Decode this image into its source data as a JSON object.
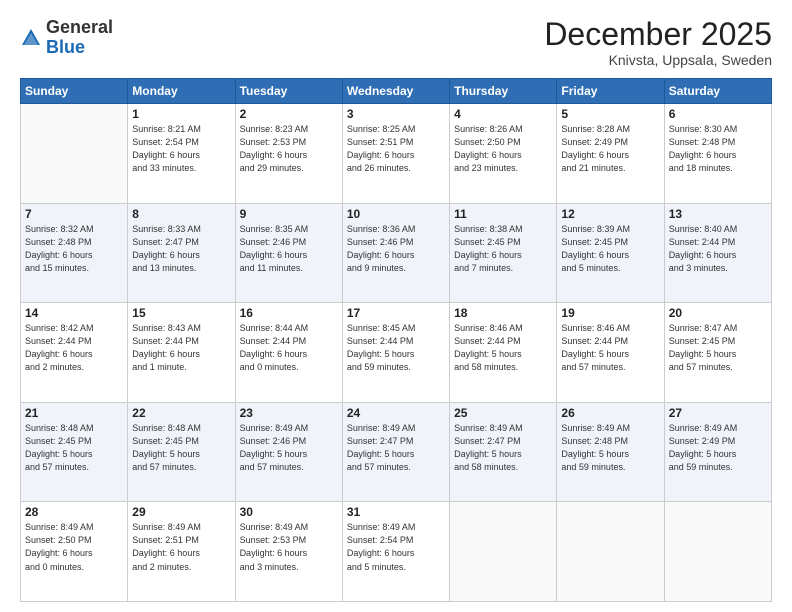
{
  "header": {
    "logo_general": "General",
    "logo_blue": "Blue",
    "month_title": "December 2025",
    "location": "Knivsta, Uppsala, Sweden"
  },
  "days_of_week": [
    "Sunday",
    "Monday",
    "Tuesday",
    "Wednesday",
    "Thursday",
    "Friday",
    "Saturday"
  ],
  "weeks": [
    [
      {
        "day": "",
        "info": ""
      },
      {
        "day": "1",
        "info": "Sunrise: 8:21 AM\nSunset: 2:54 PM\nDaylight: 6 hours\nand 33 minutes."
      },
      {
        "day": "2",
        "info": "Sunrise: 8:23 AM\nSunset: 2:53 PM\nDaylight: 6 hours\nand 29 minutes."
      },
      {
        "day": "3",
        "info": "Sunrise: 8:25 AM\nSunset: 2:51 PM\nDaylight: 6 hours\nand 26 minutes."
      },
      {
        "day": "4",
        "info": "Sunrise: 8:26 AM\nSunset: 2:50 PM\nDaylight: 6 hours\nand 23 minutes."
      },
      {
        "day": "5",
        "info": "Sunrise: 8:28 AM\nSunset: 2:49 PM\nDaylight: 6 hours\nand 21 minutes."
      },
      {
        "day": "6",
        "info": "Sunrise: 8:30 AM\nSunset: 2:48 PM\nDaylight: 6 hours\nand 18 minutes."
      }
    ],
    [
      {
        "day": "7",
        "info": "Sunrise: 8:32 AM\nSunset: 2:48 PM\nDaylight: 6 hours\nand 15 minutes."
      },
      {
        "day": "8",
        "info": "Sunrise: 8:33 AM\nSunset: 2:47 PM\nDaylight: 6 hours\nand 13 minutes."
      },
      {
        "day": "9",
        "info": "Sunrise: 8:35 AM\nSunset: 2:46 PM\nDaylight: 6 hours\nand 11 minutes."
      },
      {
        "day": "10",
        "info": "Sunrise: 8:36 AM\nSunset: 2:46 PM\nDaylight: 6 hours\nand 9 minutes."
      },
      {
        "day": "11",
        "info": "Sunrise: 8:38 AM\nSunset: 2:45 PM\nDaylight: 6 hours\nand 7 minutes."
      },
      {
        "day": "12",
        "info": "Sunrise: 8:39 AM\nSunset: 2:45 PM\nDaylight: 6 hours\nand 5 minutes."
      },
      {
        "day": "13",
        "info": "Sunrise: 8:40 AM\nSunset: 2:44 PM\nDaylight: 6 hours\nand 3 minutes."
      }
    ],
    [
      {
        "day": "14",
        "info": "Sunrise: 8:42 AM\nSunset: 2:44 PM\nDaylight: 6 hours\nand 2 minutes."
      },
      {
        "day": "15",
        "info": "Sunrise: 8:43 AM\nSunset: 2:44 PM\nDaylight: 6 hours\nand 1 minute."
      },
      {
        "day": "16",
        "info": "Sunrise: 8:44 AM\nSunset: 2:44 PM\nDaylight: 6 hours\nand 0 minutes."
      },
      {
        "day": "17",
        "info": "Sunrise: 8:45 AM\nSunset: 2:44 PM\nDaylight: 5 hours\nand 59 minutes."
      },
      {
        "day": "18",
        "info": "Sunrise: 8:46 AM\nSunset: 2:44 PM\nDaylight: 5 hours\nand 58 minutes."
      },
      {
        "day": "19",
        "info": "Sunrise: 8:46 AM\nSunset: 2:44 PM\nDaylight: 5 hours\nand 57 minutes."
      },
      {
        "day": "20",
        "info": "Sunrise: 8:47 AM\nSunset: 2:45 PM\nDaylight: 5 hours\nand 57 minutes."
      }
    ],
    [
      {
        "day": "21",
        "info": "Sunrise: 8:48 AM\nSunset: 2:45 PM\nDaylight: 5 hours\nand 57 minutes."
      },
      {
        "day": "22",
        "info": "Sunrise: 8:48 AM\nSunset: 2:45 PM\nDaylight: 5 hours\nand 57 minutes."
      },
      {
        "day": "23",
        "info": "Sunrise: 8:49 AM\nSunset: 2:46 PM\nDaylight: 5 hours\nand 57 minutes."
      },
      {
        "day": "24",
        "info": "Sunrise: 8:49 AM\nSunset: 2:47 PM\nDaylight: 5 hours\nand 57 minutes."
      },
      {
        "day": "25",
        "info": "Sunrise: 8:49 AM\nSunset: 2:47 PM\nDaylight: 5 hours\nand 58 minutes."
      },
      {
        "day": "26",
        "info": "Sunrise: 8:49 AM\nSunset: 2:48 PM\nDaylight: 5 hours\nand 59 minutes."
      },
      {
        "day": "27",
        "info": "Sunrise: 8:49 AM\nSunset: 2:49 PM\nDaylight: 5 hours\nand 59 minutes."
      }
    ],
    [
      {
        "day": "28",
        "info": "Sunrise: 8:49 AM\nSunset: 2:50 PM\nDaylight: 6 hours\nand 0 minutes."
      },
      {
        "day": "29",
        "info": "Sunrise: 8:49 AM\nSunset: 2:51 PM\nDaylight: 6 hours\nand 2 minutes."
      },
      {
        "day": "30",
        "info": "Sunrise: 8:49 AM\nSunset: 2:53 PM\nDaylight: 6 hours\nand 3 minutes."
      },
      {
        "day": "31",
        "info": "Sunrise: 8:49 AM\nSunset: 2:54 PM\nDaylight: 6 hours\nand 5 minutes."
      },
      {
        "day": "",
        "info": ""
      },
      {
        "day": "",
        "info": ""
      },
      {
        "day": "",
        "info": ""
      }
    ]
  ]
}
